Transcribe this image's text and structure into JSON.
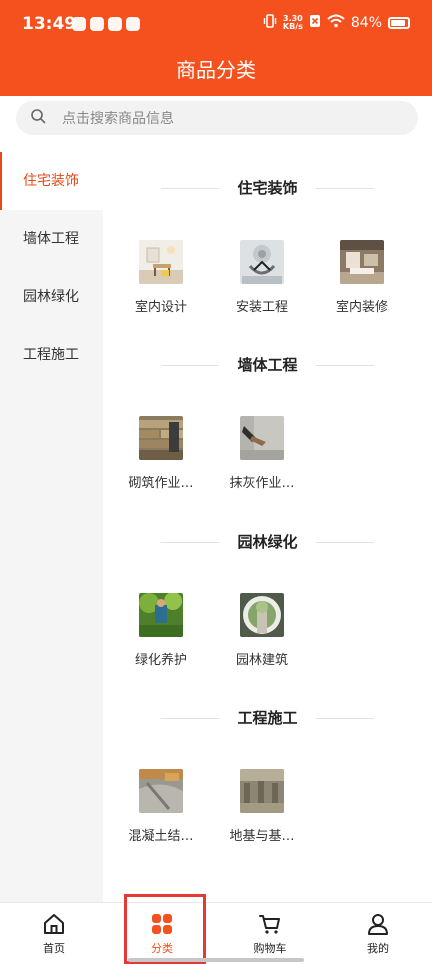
{
  "status_bar": {
    "time": "13:49",
    "net_speed_value": "3.30",
    "net_speed_unit": "KB/s",
    "battery": "84%"
  },
  "header": {
    "title": "商品分类"
  },
  "search": {
    "placeholder": "点击搜索商品信息"
  },
  "sidebar": {
    "items": [
      {
        "label": "住宅装饰",
        "active": true
      },
      {
        "label": "墙体工程",
        "active": false
      },
      {
        "label": "园林绿化",
        "active": false
      },
      {
        "label": "工程施工",
        "active": false
      }
    ]
  },
  "sections": [
    {
      "title": "住宅装饰",
      "products": [
        {
          "name": "室内设计"
        },
        {
          "name": "安装工程"
        },
        {
          "name": "室内装修"
        }
      ]
    },
    {
      "title": "墙体工程",
      "products": [
        {
          "name": "砌筑作业…"
        },
        {
          "name": "抹灰作业…"
        }
      ]
    },
    {
      "title": "园林绿化",
      "products": [
        {
          "name": "绿化养护"
        },
        {
          "name": "园林建筑"
        }
      ]
    },
    {
      "title": "工程施工",
      "products": [
        {
          "name": "混凝土结…"
        },
        {
          "name": "地基与基…"
        }
      ]
    }
  ],
  "tabbar": {
    "tabs": [
      {
        "label": "首页",
        "icon": "home-icon"
      },
      {
        "label": "分类",
        "icon": "category-grid-icon",
        "active": true
      },
      {
        "label": "购物车",
        "icon": "cart-icon"
      },
      {
        "label": "我的",
        "icon": "user-icon"
      }
    ]
  },
  "colors": {
    "brand": "#F4511E",
    "active_text": "#E64A19",
    "highlight_box": "#E53935"
  }
}
